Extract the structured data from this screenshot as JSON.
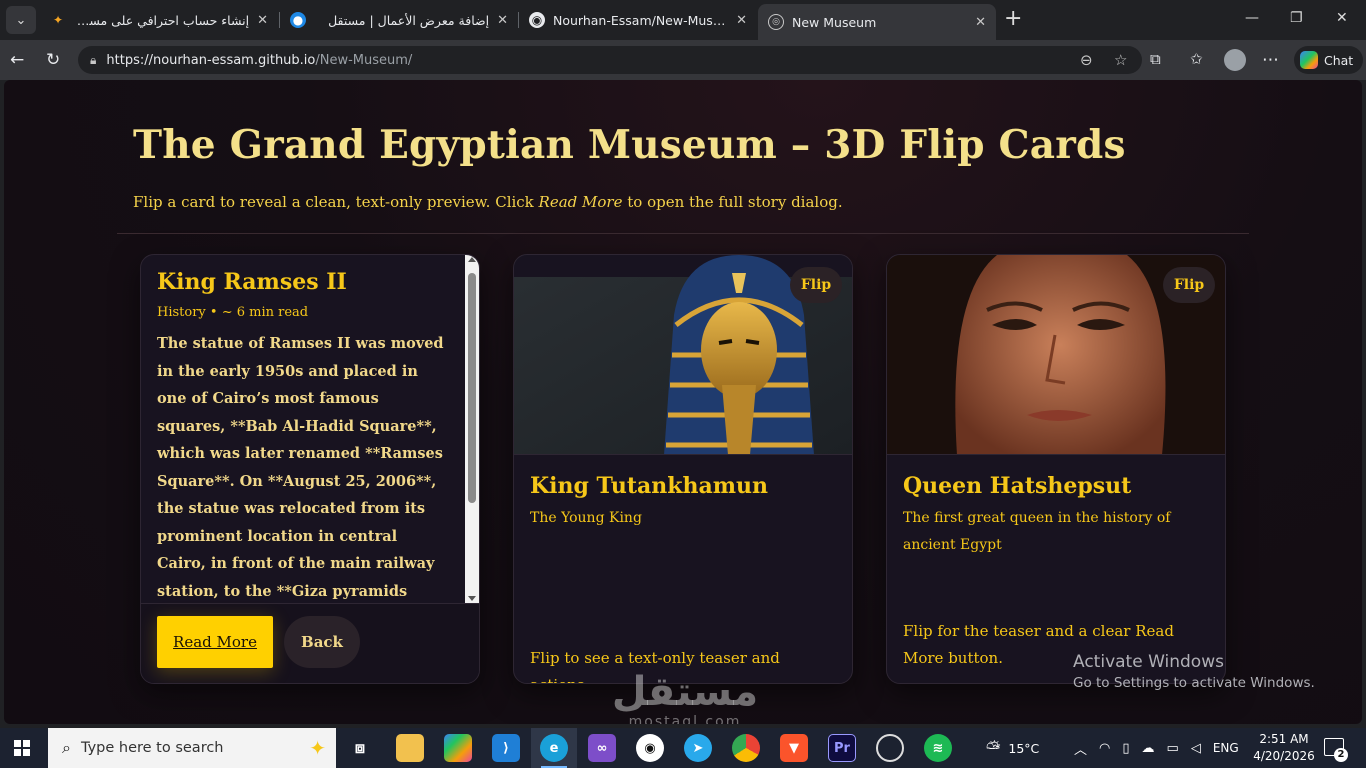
{
  "browser": {
    "tabs": [
      {
        "title": "إنشاء حساب احترافي على مستقل - ini",
        "favicon": "gemini-sparkle-icon"
      },
      {
        "title": "إضافة معرض الأعمال | مستقل",
        "favicon": "mostaql-icon"
      },
      {
        "title": "Nourhan-Essam/New-Museum",
        "favicon": "github-icon"
      },
      {
        "title": "New Museum",
        "favicon": "globe-icon"
      }
    ],
    "active_tab_index": 3,
    "url_host": "https://nourhan-essam.github.io",
    "url_path": "/New-Museum/",
    "chat_label": "Chat"
  },
  "page": {
    "title": "The Grand Egyptian Museum – 3D Flip Cards",
    "subtitle_before": "Flip a card to reveal a clean, text-only preview. Click ",
    "subtitle_em": "Read More",
    "subtitle_after": " to open the full story dialog."
  },
  "cards": [
    {
      "name": "King Ramses II",
      "meta": "History • ~ 6 min read",
      "story": "The statue of Ramses II was moved in the early 1950s and placed in one of Cairo’s most famous squares, **Bab Al-Hadid Square**, which was later renamed **Ramses Square**. On **August 25, 2006**, the statue was relocated from its prominent location in central Cairo, in front of the main railway station, to the **Giza pyramids area** for restoration work that lasted",
      "read_more": "Read More",
      "back": "Back"
    },
    {
      "name": "King Tutankhamun",
      "subtitle": "The Young King",
      "hint": "Flip to see a text-only teaser and actions.",
      "flip": "Flip"
    },
    {
      "name": "Queen Hatshepsut",
      "subtitle": "The first great queen in the history of ancient Egypt",
      "hint": "Flip for the teaser and a clear Read More button.",
      "flip": "Flip"
    }
  ],
  "overlay": {
    "activate_title": "Activate Windows",
    "activate_sub": "Go to Settings to activate Windows.",
    "watermark_ar": "مستقل",
    "watermark_en": "mostaql.com"
  },
  "taskbar": {
    "search_placeholder": "Type here to search",
    "weather": "15°C",
    "language": "ENG",
    "time": "2:51 AM",
    "date": "4/20/2026",
    "notifications": "2"
  },
  "colors": {
    "accent_gold": "#f6c719",
    "title_gold": "#f4e08a",
    "button_yellow": "#ffd000",
    "page_bg": "#150e14"
  }
}
